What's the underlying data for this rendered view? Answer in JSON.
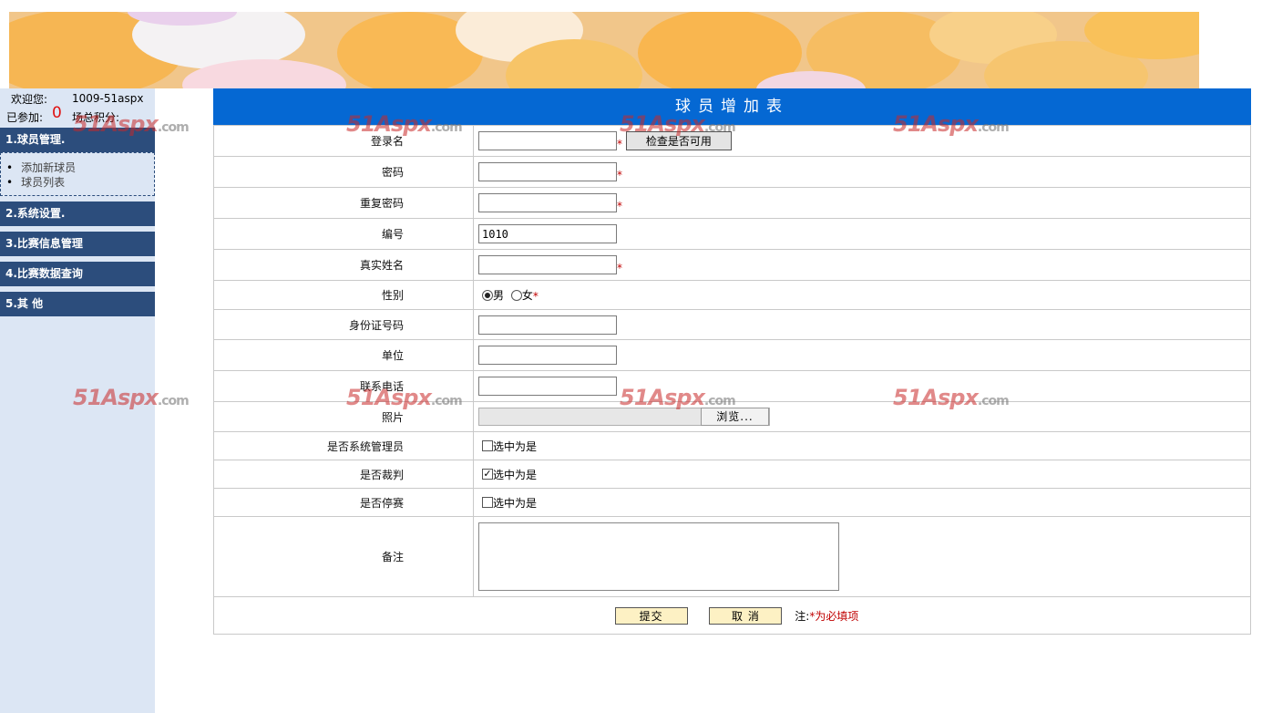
{
  "sidebar": {
    "welcome_label": "欢迎您:",
    "user_id": "1009-51aspx",
    "joined_label": "已参加:",
    "joined_count": "0",
    "points_label": "场总积分:",
    "menus": [
      {
        "label": "1.球员管理."
      },
      {
        "label": "2.系统设置."
      },
      {
        "label": "3.比赛信息管理"
      },
      {
        "label": "4.比赛数据查询"
      },
      {
        "label": "5.其  他"
      }
    ],
    "submenu": [
      "添加新球员",
      "球员列表"
    ]
  },
  "form": {
    "title": "球员增加表",
    "fields": {
      "login": {
        "label": "登录名",
        "value": ""
      },
      "check_button": "检查是否可用",
      "password": {
        "label": "密码",
        "value": ""
      },
      "repeat_password": {
        "label": "重复密码",
        "value": ""
      },
      "number": {
        "label": "编号",
        "value": "1010"
      },
      "real_name": {
        "label": "真实姓名",
        "value": ""
      },
      "gender": {
        "label": "性别",
        "male": "男",
        "female": "女"
      },
      "id_card": {
        "label": "身份证号码",
        "value": ""
      },
      "company": {
        "label": "单位",
        "value": ""
      },
      "phone": {
        "label": "联系电话",
        "value": ""
      },
      "photo": {
        "label": "照片",
        "browse": "浏览..."
      },
      "is_admin": {
        "label": "是否系统管理员",
        "option": "选中为是"
      },
      "is_referee": {
        "label": "是否裁判",
        "option": "选中为是"
      },
      "is_suspended": {
        "label": "是否停赛",
        "option": "选中为是"
      },
      "remark": {
        "label": "备注",
        "value": ""
      }
    },
    "required_mark": "*",
    "submit_label": "提交",
    "cancel_label": "取 消",
    "note_prefix": "注:",
    "note_text": "*为必填项"
  },
  "watermark": {
    "text": "51Aspx",
    "suffix": ".com"
  }
}
